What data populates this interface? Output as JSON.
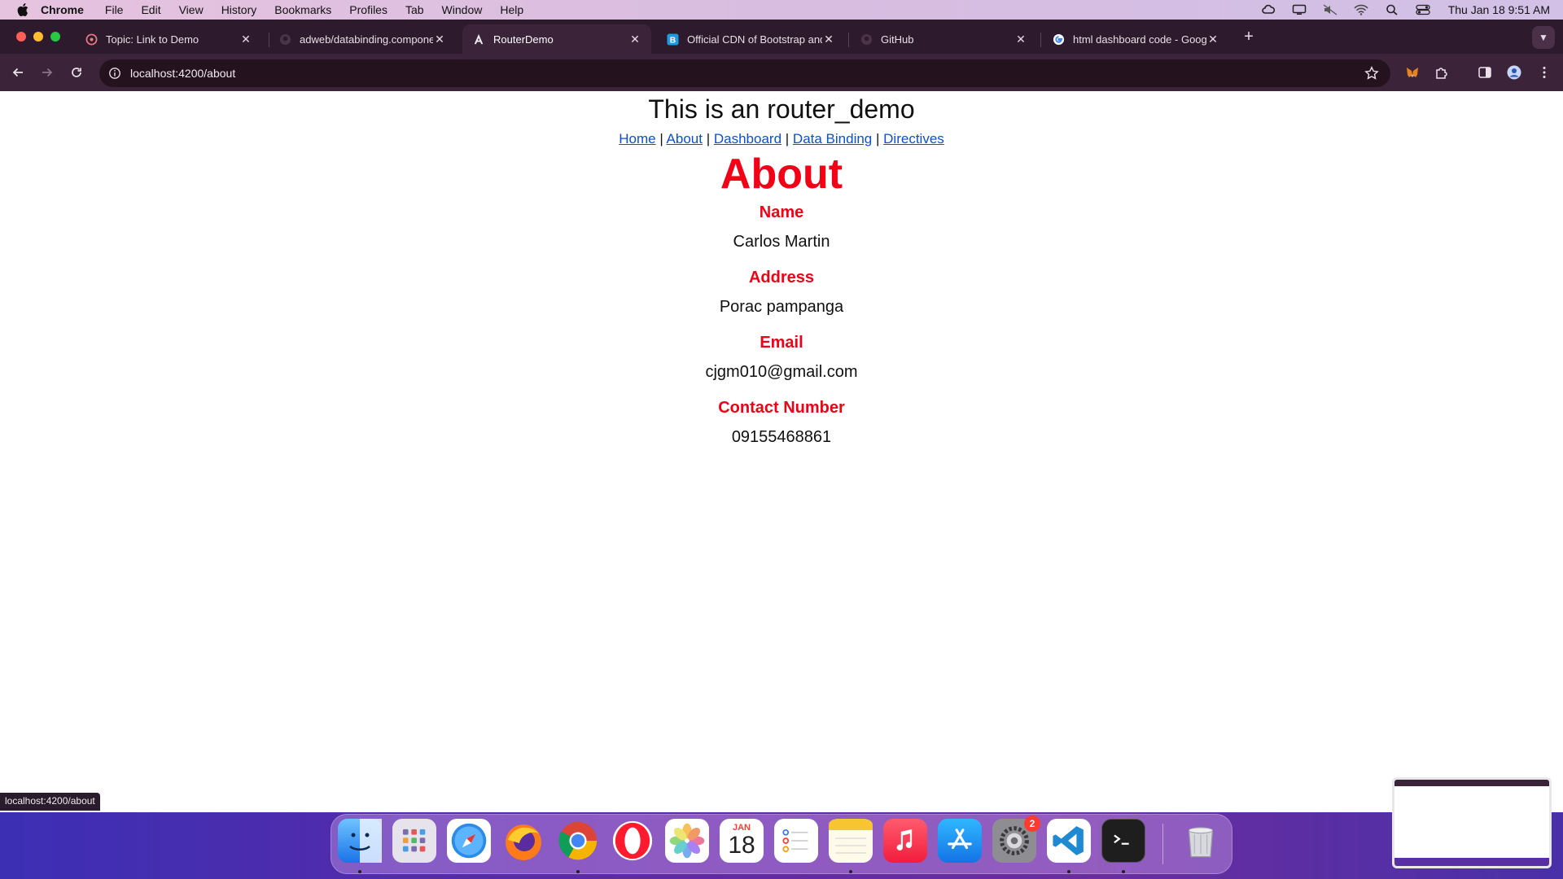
{
  "menubar": {
    "app_name": "Chrome",
    "items": [
      "File",
      "Edit",
      "View",
      "History",
      "Bookmarks",
      "Profiles",
      "Tab",
      "Window",
      "Help"
    ],
    "clock": "Thu Jan 18  9:51 AM"
  },
  "tabs": [
    {
      "title": "Topic: Link to Demo",
      "icon": "reddit-like-icon"
    },
    {
      "title": "adweb/databinding.component",
      "icon": "github-icon"
    },
    {
      "title": "RouterDemo",
      "icon": "angular-icon",
      "active": true
    },
    {
      "title": "Official CDN of Bootstrap and",
      "icon": "bootstrap-icon"
    },
    {
      "title": "GitHub",
      "icon": "github-icon"
    },
    {
      "title": "html dashboard code - Google",
      "icon": "google-icon"
    }
  ],
  "omnibox": {
    "url": "localhost:4200/about"
  },
  "page": {
    "site_title": "This is an router_demo",
    "nav": [
      {
        "label": "Home"
      },
      {
        "label": "About"
      },
      {
        "label": "Dashboard"
      },
      {
        "label": "Data Binding"
      },
      {
        "label": "Directives"
      }
    ],
    "nav_separator": "|",
    "heading": "About",
    "fields": [
      {
        "label": "Name",
        "value": "Carlos Martin"
      },
      {
        "label": "Address",
        "value": "Porac pampanga"
      },
      {
        "label": "Email",
        "value": "cjgm010@gmail.com"
      },
      {
        "label": "Contact Number",
        "value": "09155468861"
      }
    ]
  },
  "statusbar": {
    "text": "localhost:4200/about"
  },
  "dock": {
    "calendar_month": "JAN",
    "calendar_day": "18",
    "settings_badge": "2"
  },
  "colors": {
    "accent_red": "#f20016",
    "link_blue": "#0a4fd6",
    "chrome_frame": "#3b2439"
  }
}
